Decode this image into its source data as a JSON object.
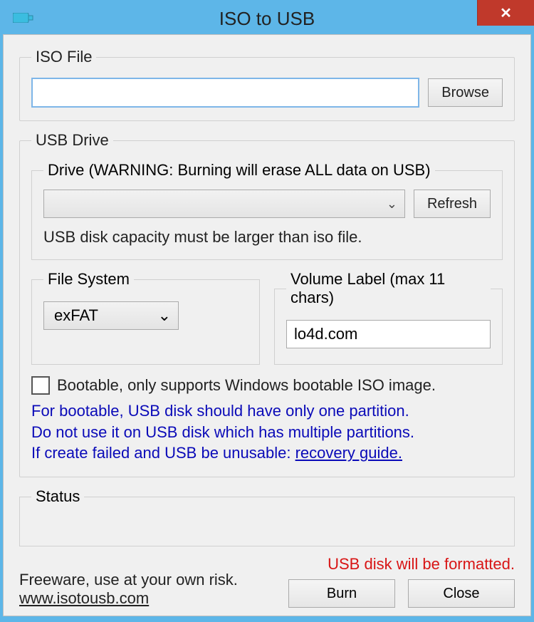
{
  "window": {
    "title": "ISO to USB"
  },
  "iso": {
    "legend": "ISO File",
    "value": "",
    "browse_label": "Browse"
  },
  "usb": {
    "legend": "USB Drive",
    "drive": {
      "legend": "Drive (WARNING: Burning will erase ALL data on USB)",
      "selected": "",
      "refresh_label": "Refresh",
      "capacity_note": "USB disk capacity must be larger than iso file."
    },
    "fs": {
      "legend": "File System",
      "selected": "exFAT"
    },
    "vol": {
      "legend": "Volume Label (max 11 chars)",
      "value": "lo4d.com"
    },
    "bootable_label": "Bootable, only supports Windows bootable ISO image.",
    "note_line1": "For bootable, USB disk should have only one partition.",
    "note_line2": "Do not use it on USB disk which has multiple partitions.",
    "note_line3_prefix": "If create failed and USB be unusable: ",
    "note_link": "recovery guide."
  },
  "status": {
    "legend": "Status"
  },
  "footer": {
    "line1": "Freeware, use at your own risk.",
    "link": "www.isotousb.com",
    "warn": "USB disk will be formatted.",
    "burn_label": "Burn",
    "close_label": "Close"
  }
}
